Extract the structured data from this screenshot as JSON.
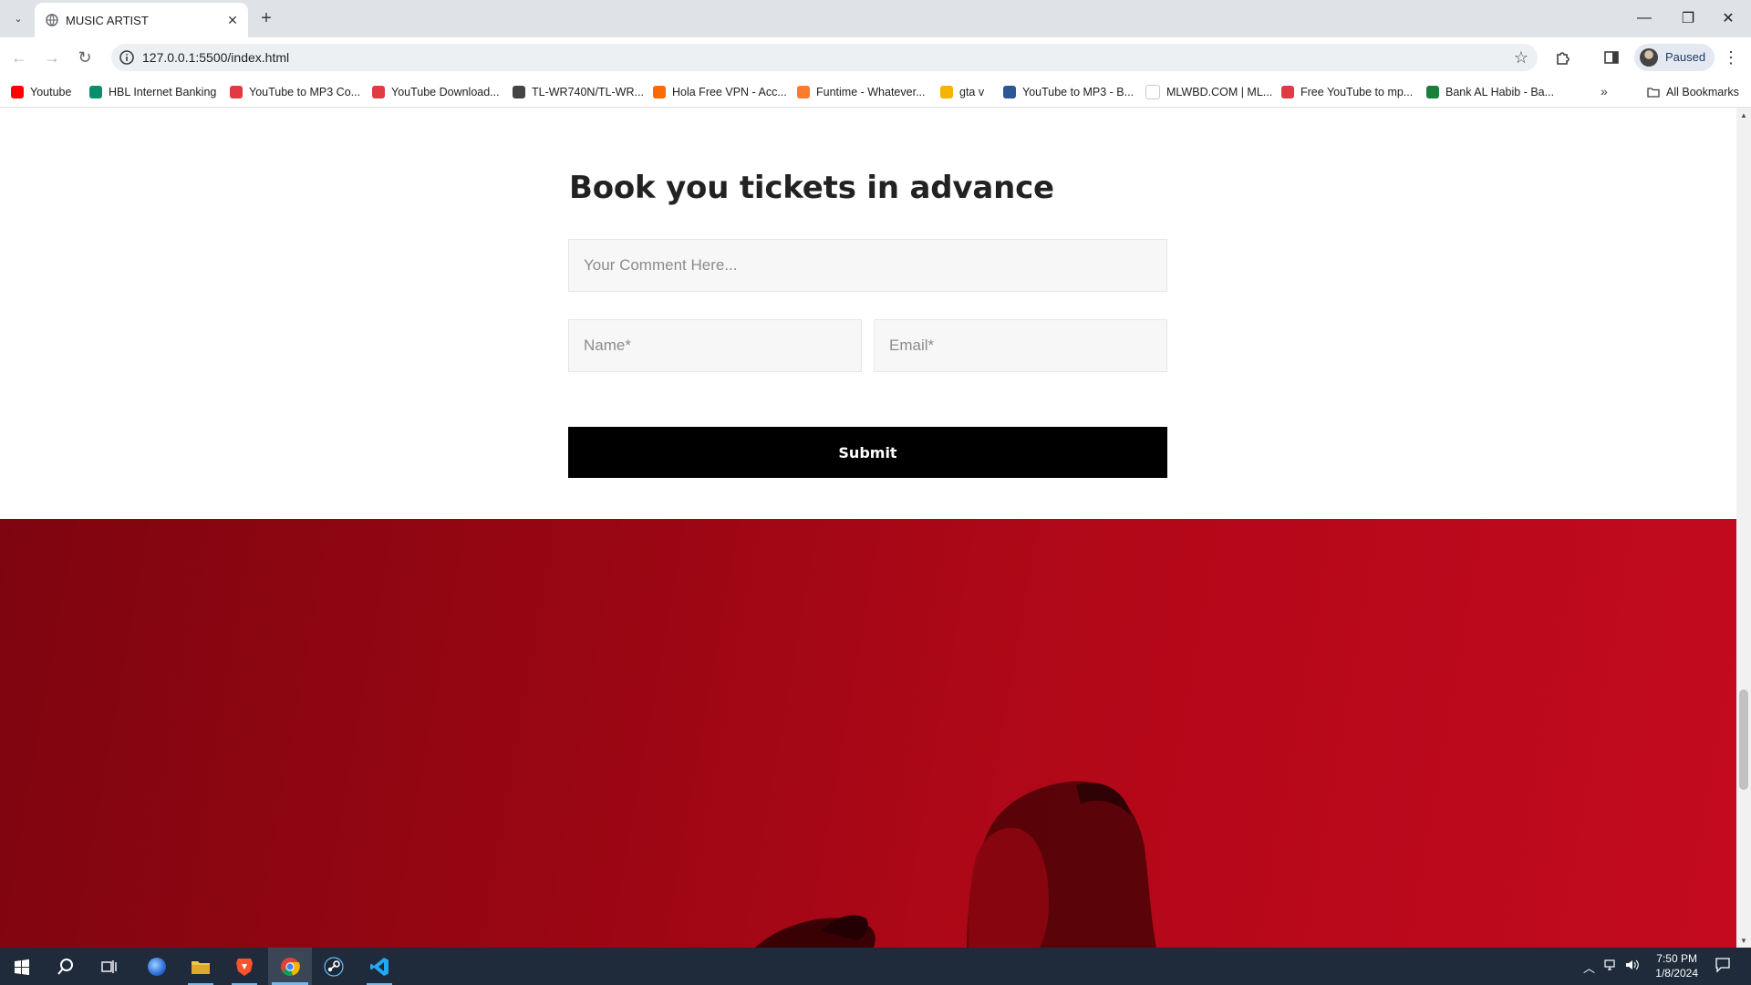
{
  "browser": {
    "tab_title": "MUSIC ARTIST",
    "url": "127.0.0.1:5500/index.html",
    "profile_label": "Paused",
    "bookmarks": [
      {
        "label": "Youtube",
        "icon": "youtube-icon",
        "color": "#ff0000"
      },
      {
        "label": "HBL Internet Banking",
        "icon": "hbl-icon",
        "color": "#0a8f6e"
      },
      {
        "label": "YouTube to MP3 Co...",
        "icon": "download-icon",
        "color": "#e23a44"
      },
      {
        "label": "YouTube Download...",
        "icon": "download-icon",
        "color": "#e23a44"
      },
      {
        "label": "TL-WR740N/TL-WR...",
        "icon": "globe-icon",
        "color": "#444444"
      },
      {
        "label": "Hola Free VPN - Acc...",
        "icon": "flame-icon",
        "color": "#ff6a00"
      },
      {
        "label": "Funtime - Whatever...",
        "icon": "funtime-icon",
        "color": "#ff7b2c"
      },
      {
        "label": "gta v",
        "icon": "rockstar-icon",
        "color": "#f6b400"
      },
      {
        "label": "YouTube to MP3 - B...",
        "icon": "download-icon",
        "color": "#2b5797"
      },
      {
        "label": "MLWBD.COM | ML...",
        "icon": "blank-page-icon",
        "color": "#ffffff"
      },
      {
        "label": "Free YouTube to mp...",
        "icon": "link-icon",
        "color": "#e23a44"
      },
      {
        "label": "Bank AL Habib - Ba...",
        "icon": "bank-icon",
        "color": "#1a7f3b"
      }
    ],
    "all_bookmarks_label": "All Bookmarks"
  },
  "page": {
    "form_title": "Book you tickets in advance",
    "comment_placeholder": "Your Comment Here...",
    "name_placeholder": "Name*",
    "email_placeholder": "Email*",
    "submit_label": "Submit"
  },
  "taskbar": {
    "time": "7:50 PM",
    "date": "1/8/2024",
    "apps": [
      "start-icon",
      "search-icon",
      "task-view-icon",
      "cortana-icon",
      "file-explorer-icon",
      "brave-icon",
      "chrome-icon",
      "steam-icon",
      "vscode-icon"
    ]
  },
  "colors": {
    "submit_bg": "#000000",
    "hero_red": "#e3102a"
  }
}
